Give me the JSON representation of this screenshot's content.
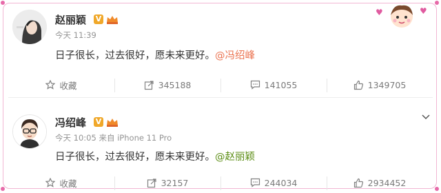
{
  "colors": {
    "frame": "#f2b5d3",
    "accent_mention_1": "#eb7350",
    "accent_mention_2": "#5b8d14",
    "verified_badge": "#f0a82a",
    "muted_text": "#939393"
  },
  "posts": [
    {
      "author": "赵丽颖",
      "verified_badge": "V",
      "time": "今天 11:39",
      "source": "",
      "text_body": "日子很长，过去很好，愿未来更好。",
      "mention": "@冯绍峰",
      "actions": {
        "favorite_label": "收藏",
        "repost_count": "345188",
        "comment_count": "141055",
        "like_count": "1349705"
      }
    },
    {
      "author": "冯绍峰",
      "verified_badge": "V",
      "time": "今天 10:05",
      "source": "来自 iPhone 11 Pro",
      "text_body": "日子很长，过去很好，愿未来更好。",
      "mention": "@赵丽颖",
      "actions": {
        "favorite_label": "收藏",
        "repost_count": "32157",
        "comment_count": "244034",
        "like_count": "2934452"
      }
    }
  ],
  "icons": {
    "favorite": "star-icon",
    "repost": "repost-icon",
    "comment": "comment-icon",
    "like": "thumbs-up-icon",
    "more": "chevron-down-icon",
    "membership": "crown-icon",
    "decoration": "cartoon-sticker-icon"
  }
}
